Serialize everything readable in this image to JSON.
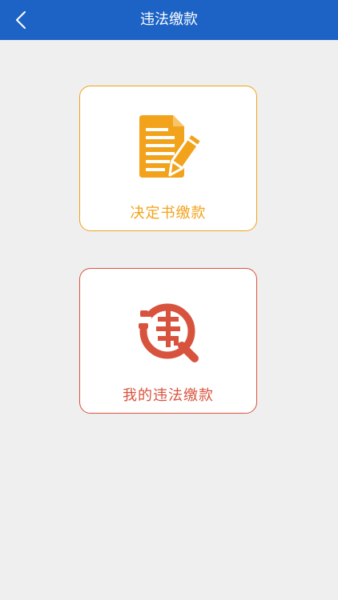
{
  "header": {
    "title": "违法缴款",
    "back_icon": "chevron-left-icon"
  },
  "cards": [
    {
      "label": "决定书缴款",
      "icon": "document-pen-icon",
      "color": "#f2a31b"
    },
    {
      "label": "我的违法缴款",
      "icon": "violation-search-icon",
      "color": "#d8533d"
    }
  ],
  "colors": {
    "navbar": "#1d63c5",
    "background": "#efefef"
  }
}
